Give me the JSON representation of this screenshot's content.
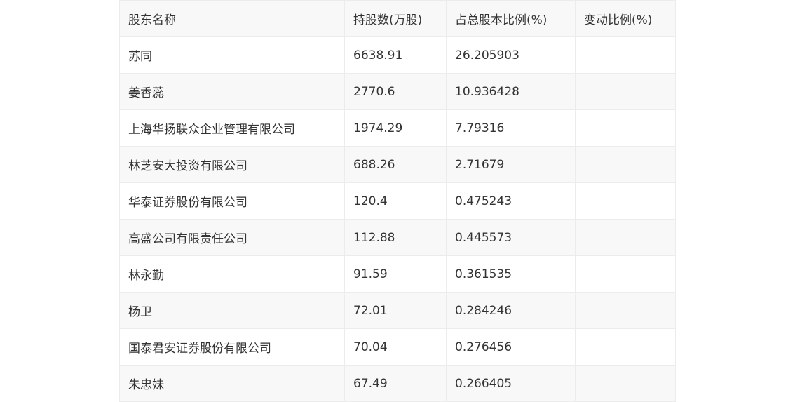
{
  "table": {
    "headers": [
      "股东名称",
      "持股数(万股)",
      "占总股本比例(%)",
      "变动比例(%)"
    ],
    "rows": [
      {
        "name": "苏同",
        "shares": "6638.91",
        "ratio": "26.205903",
        "change": ""
      },
      {
        "name": "姜香蕊",
        "shares": "2770.6",
        "ratio": "10.936428",
        "change": ""
      },
      {
        "name": "上海华扬联众企业管理有限公司",
        "shares": "1974.29",
        "ratio": "7.79316",
        "change": ""
      },
      {
        "name": "林芝安大投资有限公司",
        "shares": "688.26",
        "ratio": "2.71679",
        "change": ""
      },
      {
        "name": "华泰证券股份有限公司",
        "shares": "120.4",
        "ratio": "0.475243",
        "change": ""
      },
      {
        "name": "高盛公司有限责任公司",
        "shares": "112.88",
        "ratio": "0.445573",
        "change": ""
      },
      {
        "name": "林永勤",
        "shares": "91.59",
        "ratio": "0.361535",
        "change": ""
      },
      {
        "name": "杨卫",
        "shares": "72.01",
        "ratio": "0.284246",
        "change": ""
      },
      {
        "name": "国泰君安证券股份有限公司",
        "shares": "70.04",
        "ratio": "0.276456",
        "change": ""
      },
      {
        "name": "朱忠妹",
        "shares": "67.49",
        "ratio": "0.266405",
        "change": ""
      }
    ]
  }
}
